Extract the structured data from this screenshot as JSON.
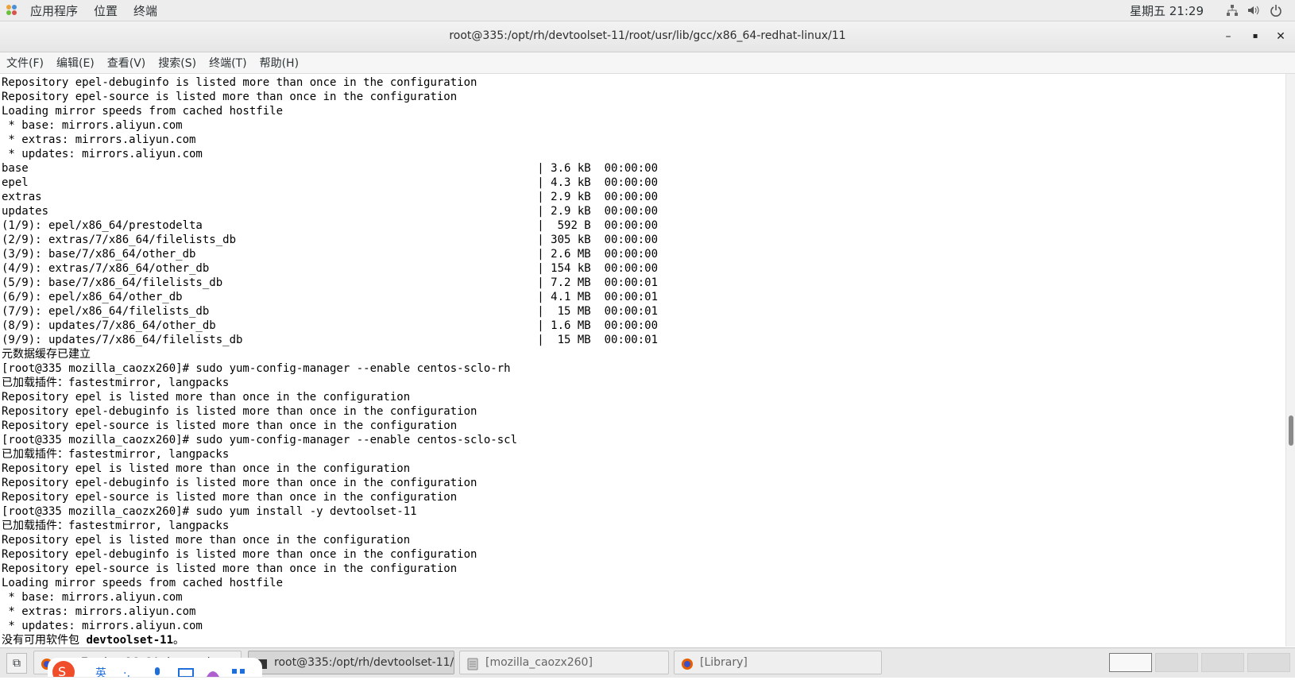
{
  "top_panel": {
    "menus": [
      "应用程序",
      "位置",
      "终端"
    ],
    "clock": "星期五 21:29",
    "tray": [
      "network-icon",
      "volume-icon",
      "power-icon"
    ]
  },
  "window": {
    "title": "root@335:/opt/rh/devtoolset-11/root/usr/lib/gcc/x86_64-redhat-linux/11",
    "minimize": "–",
    "maximize": "▪",
    "close": "✕"
  },
  "menubar": [
    "文件(F)",
    "编辑(E)",
    "查看(V)",
    "搜索(S)",
    "终端(T)",
    "帮助(H)"
  ],
  "terminal": {
    "lines": [
      "Repository epel-debuginfo is listed more than once in the configuration",
      "Repository epel-source is listed more than once in the configuration",
      "Loading mirror speeds from cached hostfile",
      " * base: mirrors.aliyun.com",
      " * extras: mirrors.aliyun.com",
      " * updates: mirrors.aliyun.com",
      "base                                                                            | 3.6 kB  00:00:00",
      "epel                                                                            | 4.3 kB  00:00:00",
      "extras                                                                          | 2.9 kB  00:00:00",
      "updates                                                                         | 2.9 kB  00:00:00",
      "(1/9): epel/x86_64/prestodelta                                                  |  592 B  00:00:00",
      "(2/9): extras/7/x86_64/filelists_db                                             | 305 kB  00:00:00",
      "(3/9): base/7/x86_64/other_db                                                   | 2.6 MB  00:00:00",
      "(4/9): extras/7/x86_64/other_db                                                 | 154 kB  00:00:00",
      "(5/9): base/7/x86_64/filelists_db                                               | 7.2 MB  00:00:01",
      "(6/9): epel/x86_64/other_db                                                     | 4.1 MB  00:00:01",
      "(7/9): epel/x86_64/filelists_db                                                 |  15 MB  00:00:01",
      "(8/9): updates/7/x86_64/other_db                                                | 1.6 MB  00:00:00",
      "(9/9): updates/7/x86_64/filelists_db                                            |  15 MB  00:00:01",
      "元数据缓存已建立",
      "[root@335 mozilla_caozx260]# sudo yum-config-manager --enable centos-sclo-rh",
      "已加载插件：fastestmirror, langpacks",
      "Repository epel is listed more than once in the configuration",
      "Repository epel-debuginfo is listed more than once in the configuration",
      "Repository epel-source is listed more than once in the configuration",
      "[root@335 mozilla_caozx260]# sudo yum-config-manager --enable centos-sclo-scl",
      "已加载插件：fastestmirror, langpacks",
      "Repository epel is listed more than once in the configuration",
      "Repository epel-debuginfo is listed more than once in the configuration",
      "Repository epel-source is listed more than once in the configuration",
      "[root@335 mozilla_caozx260]# sudo yum install -y devtoolset-11",
      "已加载插件：fastestmirror, langpacks",
      "Repository epel is listed more than once in the configuration",
      "Repository epel-debuginfo is listed more than once in the configuration",
      "Repository epel-source is listed more than once in the configuration",
      "Loading mirror speeds from cached hostfile",
      " * base: mirrors.aliyun.com",
      " * extras: mirrors.aliyun.com",
      " * updates: mirrors.aliyun.com",
      "没有可用软件包 devtoolset-11。"
    ]
  },
  "taskbar": {
    "tasks": [
      {
        "label": "...e-7-sclo-x86_64-rh-repodata...",
        "icon": "firefox-icon",
        "active": false
      },
      {
        "label": "root@335:/opt/rh/devtoolset-11/r...",
        "icon": "terminal-icon",
        "active": true
      },
      {
        "label": "[mozilla_caozx260]",
        "icon": "file-manager-icon",
        "active": false
      },
      {
        "label": "[Library]",
        "icon": "firefox-icon",
        "active": false
      }
    ],
    "workspaces": 4,
    "current_workspace": 1
  },
  "colors": {
    "panel": "#ededed",
    "terminal_bg": "#ffffff",
    "terminal_fg": "#000000",
    "firefox": "#e66000"
  }
}
